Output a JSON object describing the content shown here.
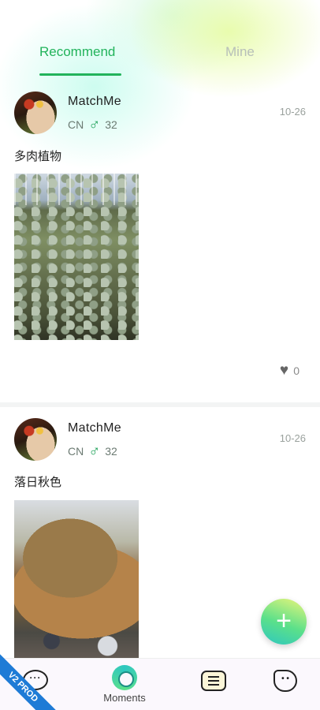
{
  "tabs": {
    "recommend": "Recommend",
    "mine": "Mine",
    "active": "recommend"
  },
  "posts": [
    {
      "username": "MatchMe",
      "country": "CN",
      "gender_icon": "male-icon",
      "gender_symbol": "♂",
      "age": "32",
      "date": "10-26",
      "text": "多肉植物",
      "image": "greenhouse-succulents-photo",
      "likes": "0"
    },
    {
      "username": "MatchMe",
      "country": "CN",
      "gender_icon": "male-icon",
      "gender_symbol": "♂",
      "age": "32",
      "date": "10-26",
      "text": "落日秋色",
      "image": "autumn-tree-photo"
    }
  ],
  "fab": {
    "icon": "plus-icon",
    "symbol": "+"
  },
  "bottom_nav": {
    "items": [
      {
        "icon": "chat-bubble-icon",
        "label": ""
      },
      {
        "icon": "moments-icon",
        "label": "Moments"
      },
      {
        "icon": "list-icon",
        "label": ""
      },
      {
        "icon": "face-icon",
        "label": ""
      }
    ]
  },
  "badge": "V2 PROD",
  "colors": {
    "accent": "#22b35b",
    "inactive_tab": "#b7bfb9",
    "badge": "#1e7bd6"
  }
}
